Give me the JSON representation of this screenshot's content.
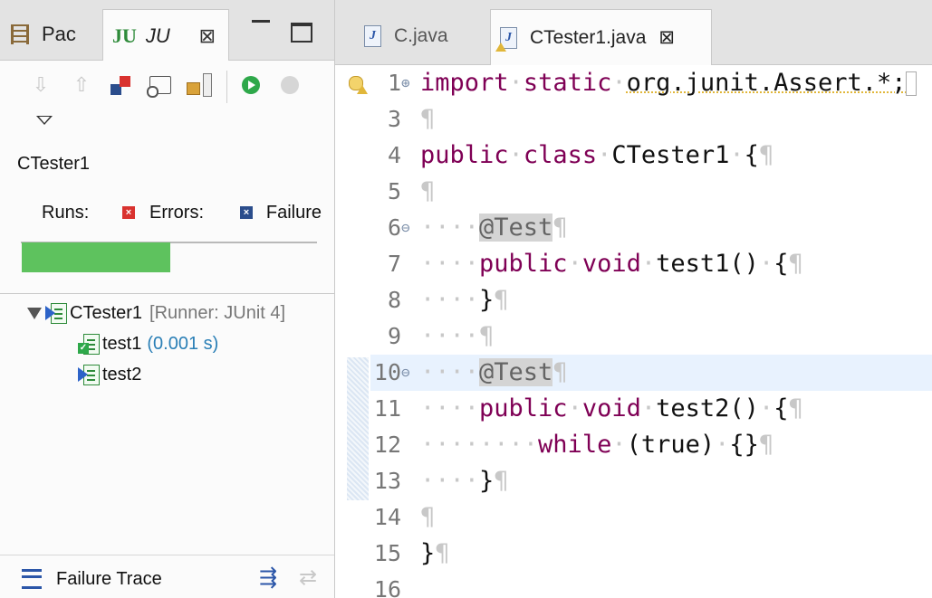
{
  "left_panel": {
    "tabs": {
      "package_explorer": {
        "label": "Pac",
        "icon": "package-explorer-icon"
      },
      "junit": {
        "icon_text": "JU",
        "label": "JU",
        "close_symbol": "⊠"
      }
    },
    "test_class": "CTester1",
    "stats": {
      "runs_label": "Runs:",
      "errors_label": "Errors:",
      "failures_label": "Failure"
    },
    "progress": {
      "fraction": 0.5,
      "color": "#5ec25e"
    },
    "tree": {
      "root": {
        "label": "CTester1",
        "runner": "[Runner: JUnit 4]"
      },
      "tests": [
        {
          "label": "test1",
          "time": "(0.001 s)",
          "status": "passed"
        },
        {
          "label": "test2",
          "time": "",
          "status": "running"
        }
      ]
    },
    "failure_trace_label": "Failure Trace"
  },
  "editor": {
    "tabs": {
      "c_java": "C.java",
      "ctester1_java": "CTester1.java"
    },
    "lines": [
      {
        "num": "1",
        "fold": "⊕"
      },
      {
        "num": "3"
      },
      {
        "num": "4"
      },
      {
        "num": "5"
      },
      {
        "num": "6",
        "fold": "⊖"
      },
      {
        "num": "7"
      },
      {
        "num": "8"
      },
      {
        "num": "9"
      },
      {
        "num": "10",
        "fold": "⊖"
      },
      {
        "num": "11"
      },
      {
        "num": "12"
      },
      {
        "num": "13"
      },
      {
        "num": "14"
      },
      {
        "num": "15"
      },
      {
        "num": "16"
      }
    ],
    "tokens": {
      "import": "import",
      "static": "static",
      "package": "org.junit.Assert.*;",
      "public": "public",
      "class": "class",
      "class_name": "CTester1",
      "brace_open": "{",
      "brace_close": "}",
      "annotation": "@Test",
      "void": "void",
      "method1": "test1()",
      "method2": "test2()",
      "while": "while",
      "condition": "(true)",
      "empty_block": "{}"
    },
    "colors": {
      "keyword": "#7f0055",
      "annotation": "#646464",
      "current_line": "#e8f2fe"
    }
  }
}
